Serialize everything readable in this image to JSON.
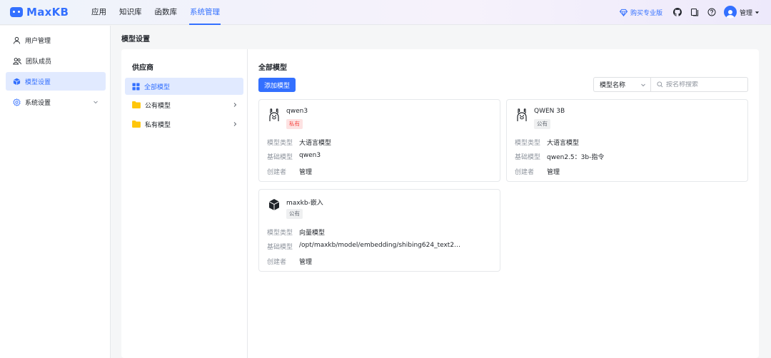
{
  "app": {
    "logo_text": "MaxKB"
  },
  "header": {
    "nav": [
      {
        "label": "应用"
      },
      {
        "label": "知识库"
      },
      {
        "label": "函数库"
      },
      {
        "label": "系统管理"
      }
    ],
    "upgrade_label": "购买专业版",
    "user_name": "管理",
    "accent_color": "#3370ff"
  },
  "sidebar": {
    "items": [
      {
        "label": "用户管理",
        "icon": "user-icon"
      },
      {
        "label": "团队成员",
        "icon": "team-icon"
      },
      {
        "label": "模型设置",
        "icon": "cube-icon"
      },
      {
        "label": "系统设置",
        "icon": "gear-icon"
      }
    ]
  },
  "page": {
    "title": "模型设置"
  },
  "providers": {
    "title": "供应商",
    "items": [
      {
        "label": "全部模型"
      },
      {
        "label": "公有模型"
      },
      {
        "label": "私有模型"
      }
    ]
  },
  "models": {
    "title": "全部模型",
    "add_label": "添加模型",
    "filter_value": "模型名称",
    "search_placeholder": "按名称搜索",
    "field_labels": {
      "type": "模型类型",
      "base": "基础模型",
      "creator": "创建者"
    },
    "cards": [
      {
        "name": "qwen3",
        "badge": "私有",
        "type": "大语言模型",
        "base": "qwen3",
        "creator": "管理",
        "icon": "llama-icon"
      },
      {
        "name": "QWEN 3B",
        "badge": "公有",
        "type": "大语言模型",
        "base": "qwen2.5：3b-指令",
        "creator": "管理",
        "icon": "llama-icon"
      },
      {
        "name": "maxkb-嵌入",
        "badge": "公有",
        "type": "向量模型",
        "base": "/opt/maxkb/model/embedding/shibing624_text2…",
        "creator": "管理",
        "icon": "cube-icon"
      }
    ]
  }
}
